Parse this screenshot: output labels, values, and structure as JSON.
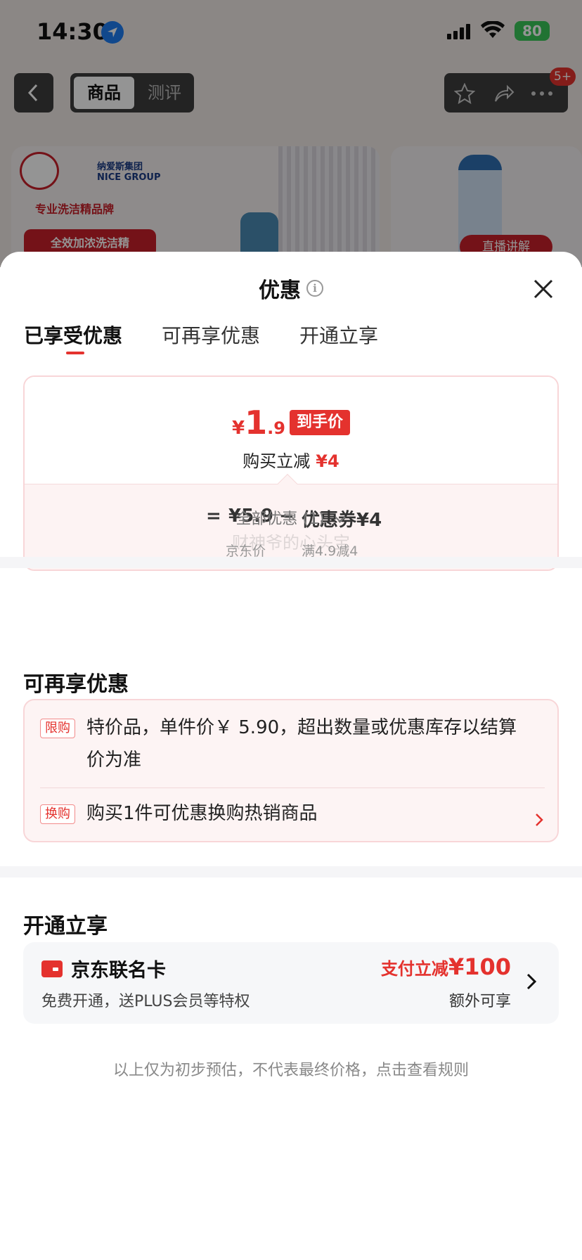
{
  "status_bar": {
    "time": "14:30",
    "battery": "80"
  },
  "nav": {
    "tab_active": "商品",
    "tab_inactive": "测评",
    "badge": "5+"
  },
  "background": {
    "brand_group_cn": "纳爱斯集团",
    "brand_group_en": "NICE GROUP",
    "slogan": "专业洗洁精品牌",
    "pill_text": "全效加浓洗洁精",
    "live_label": "直播讲解"
  },
  "sheet": {
    "title": "优惠",
    "info_icon": "i",
    "tabs": [
      "已享受优惠",
      "可再享优惠",
      "开通立享"
    ],
    "price_card": {
      "currency": "¥",
      "price_int": "1",
      "price_dec": ".9",
      "final_tag": "到手价",
      "discount_label": "购买立减",
      "discount_value": "¥4",
      "eq": "=",
      "jd_price": "¥5.9",
      "minus": "−",
      "coupon": "优惠券¥4",
      "jd_price_label": "京东价",
      "coupon_rule": "满4.9减4"
    },
    "all_offers": "全部优惠 (1)",
    "watermark": "财神爷的心头宝",
    "more_offers_title": "可再享优惠",
    "offers": [
      {
        "tag": "限购",
        "line1": "特价品，单件价￥ 5.90，超出数量或优惠库存以结算",
        "line2": "价为准"
      },
      {
        "tag": "换购",
        "line1": "购买1件可优惠换购热销商品"
      }
    ],
    "open_title": "开通立享",
    "card": {
      "name": "京东联名卡",
      "desc": "免费开通，送PLUS会员等特权",
      "promo_prefix": "支付立减",
      "promo_amount": "¥100",
      "extra": "额外可享"
    },
    "footnote": "以上仅为初步预估，不代表最终价格，点击查看规则"
  },
  "colors": {
    "accent": "#e4322e",
    "card_border": "#f8d6d8",
    "card_bg": "#fdf4f4"
  }
}
